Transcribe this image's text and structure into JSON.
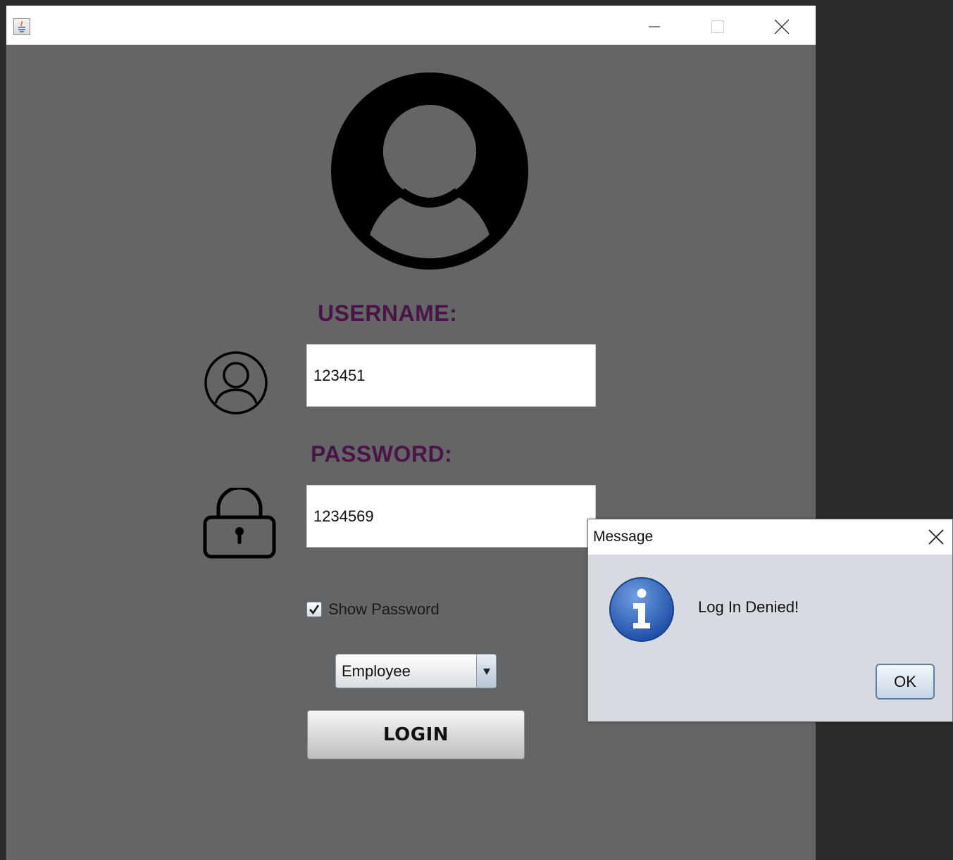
{
  "window": {
    "title": "",
    "app_icon": "java-icon",
    "controls": [
      "minimize-icon",
      "maximize-icon",
      "close-icon"
    ]
  },
  "login": {
    "username_label": "USERNAME:",
    "username_value": "123451",
    "password_label": "PASSWORD:",
    "password_value": "1234569",
    "show_password_label": "Show Password",
    "show_password_checked": true,
    "role_selected": "Employee",
    "login_button": "LOGIN",
    "label_color": "#4b1446",
    "background_color": "#646567"
  },
  "dialog": {
    "title": "Message",
    "message": "Log In Denied!",
    "ok_label": "OK",
    "icon": "info-icon"
  }
}
